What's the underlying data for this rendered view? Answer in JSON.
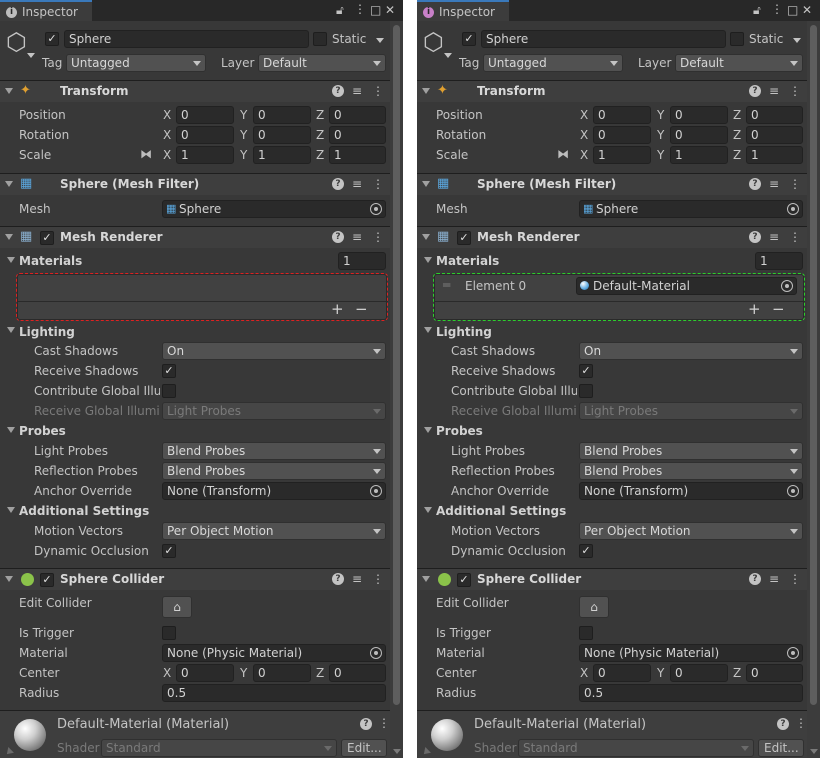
{
  "panels": [
    {
      "tab": {
        "label": "Inspector",
        "icon": "info-icon"
      },
      "object": {
        "name": "Sphere",
        "static_label": "Static",
        "tag_label": "Tag",
        "tag_value": "Untagged",
        "layer_label": "Layer",
        "layer_value": "Default"
      },
      "transform": {
        "title": "Transform",
        "position_label": "Position",
        "rotation_label": "Rotation",
        "scale_label": "Scale",
        "x": "X",
        "y": "Y",
        "z": "Z",
        "position": [
          "0",
          "0",
          "0"
        ],
        "rotation": [
          "0",
          "0",
          "0"
        ],
        "scale": [
          "1",
          "1",
          "1"
        ]
      },
      "mesh_filter": {
        "title": "Sphere (Mesh Filter)",
        "mesh_label": "Mesh",
        "mesh_value": "Sphere"
      },
      "mesh_renderer": {
        "title": "Mesh Renderer",
        "materials_label": "Materials",
        "materials_count": "1",
        "element_label": "",
        "element_value": "",
        "plus": "+",
        "minus": "−",
        "lighting": "Lighting",
        "cast_shadows_label": "Cast Shadows",
        "cast_shadows_value": "On",
        "receive_shadows_label": "Receive Shadows",
        "contribute_gi_label": "Contribute Global Illum",
        "receive_gi_label": "Receive Global Illumin",
        "receive_gi_value": "Light Probes",
        "probes": "Probes",
        "light_probes_label": "Light Probes",
        "light_probes_value": "Blend Probes",
        "reflection_probes_label": "Reflection Probes",
        "reflection_probes_value": "Blend Probes",
        "anchor_label": "Anchor Override",
        "anchor_value": "None (Transform)",
        "additional": "Additional Settings",
        "motion_label": "Motion Vectors",
        "motion_value": "Per Object Motion",
        "occlusion_label": "Dynamic Occlusion"
      },
      "sphere_collider": {
        "title": "Sphere Collider",
        "edit_label": "Edit Collider",
        "trigger_label": "Is Trigger",
        "material_label": "Material",
        "material_value": "None (Physic Material)",
        "center_label": "Center",
        "center": [
          "0",
          "0",
          "0"
        ],
        "radius_label": "Radius",
        "radius_value": "0.5"
      },
      "material_preview": {
        "title": "Default-Material (Material)",
        "shader_label": "Shader",
        "shader_value": "Standard",
        "edit_label": "Edit..."
      }
    },
    {
      "tab": {
        "label": "Inspector",
        "icon": "info-icon"
      },
      "object": {
        "name": "Sphere",
        "static_label": "Static",
        "tag_label": "Tag",
        "tag_value": "Untagged",
        "layer_label": "Layer",
        "layer_value": "Default"
      },
      "transform": {
        "title": "Transform",
        "position_label": "Position",
        "rotation_label": "Rotation",
        "scale_label": "Scale",
        "x": "X",
        "y": "Y",
        "z": "Z",
        "position": [
          "0",
          "0",
          "0"
        ],
        "rotation": [
          "0",
          "0",
          "0"
        ],
        "scale": [
          "1",
          "1",
          "1"
        ]
      },
      "mesh_filter": {
        "title": "Sphere (Mesh Filter)",
        "mesh_label": "Mesh",
        "mesh_value": "Sphere"
      },
      "mesh_renderer": {
        "title": "Mesh Renderer",
        "materials_label": "Materials",
        "materials_count": "1",
        "element_label": "Element 0",
        "element_value": "Default-Material",
        "plus": "+",
        "minus": "−",
        "lighting": "Lighting",
        "cast_shadows_label": "Cast Shadows",
        "cast_shadows_value": "On",
        "receive_shadows_label": "Receive Shadows",
        "contribute_gi_label": "Contribute Global Illum",
        "receive_gi_label": "Receive Global Illumin",
        "receive_gi_value": "Light Probes",
        "probes": "Probes",
        "light_probes_label": "Light Probes",
        "light_probes_value": "Blend Probes",
        "reflection_probes_label": "Reflection Probes",
        "reflection_probes_value": "Blend Probes",
        "anchor_label": "Anchor Override",
        "anchor_value": "None (Transform)",
        "additional": "Additional Settings",
        "motion_label": "Motion Vectors",
        "motion_value": "Per Object Motion",
        "occlusion_label": "Dynamic Occlusion"
      },
      "sphere_collider": {
        "title": "Sphere Collider",
        "edit_label": "Edit Collider",
        "trigger_label": "Is Trigger",
        "material_label": "Material",
        "material_value": "None (Physic Material)",
        "center_label": "Center",
        "center": [
          "0",
          "0",
          "0"
        ],
        "radius_label": "Radius",
        "radius_value": "0.5"
      },
      "material_preview": {
        "title": "Default-Material (Material)",
        "shader_label": "Shader",
        "shader_value": "Standard",
        "edit_label": "Edit..."
      }
    }
  ]
}
